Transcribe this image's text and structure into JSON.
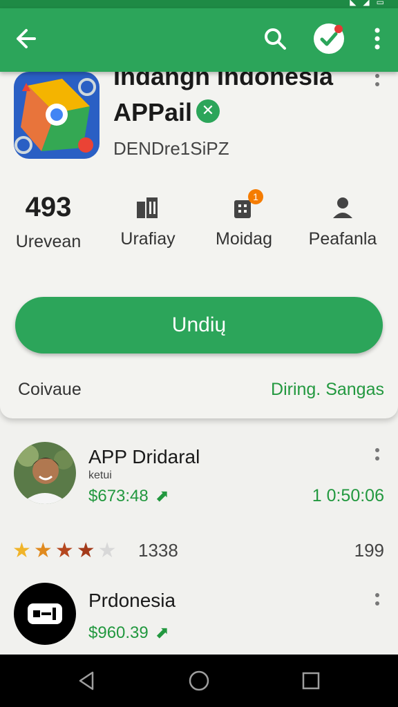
{
  "app_bar": {
    "back_icon": "arrow-left-icon",
    "search_icon": "search-icon",
    "check_icon": "check-circle-icon",
    "overflow_icon": "more-vertical-icon"
  },
  "header": {
    "title": "Indangn Indonesia",
    "subtitle": "APPail",
    "code": "DENDre1SiPZ",
    "verified_icon": "verified-badge-icon"
  },
  "stats": [
    {
      "value": "493",
      "label": "Urevean"
    },
    {
      "icon": "building-icon",
      "label": "Urafiay"
    },
    {
      "icon": "briefcase-icon",
      "badge": "1",
      "label": "Moidag"
    },
    {
      "icon": "person-icon",
      "label": "Peafanla"
    }
  ],
  "install_label": "Undių",
  "footer": {
    "left": "Coivaue",
    "right": "Diring. Sangas"
  },
  "items": [
    {
      "title": "APP Dridaral",
      "sub": "ketui",
      "price": "$673:48",
      "time": "1 0:50:06"
    },
    {
      "title": "Prdonesia",
      "price": "$960.39"
    }
  ],
  "rating": {
    "value": 4,
    "of": 5,
    "count": "1338",
    "right": "199"
  },
  "colors": {
    "primary": "#2ca55a",
    "primary_dark": "#1e8a45",
    "accent_text": "#22983f",
    "badge": "#f57c00",
    "alert_dot": "#e53935"
  },
  "nav": {
    "back": "triangle-back-icon",
    "home": "circle-home-icon",
    "recents": "square-recents-icon"
  }
}
